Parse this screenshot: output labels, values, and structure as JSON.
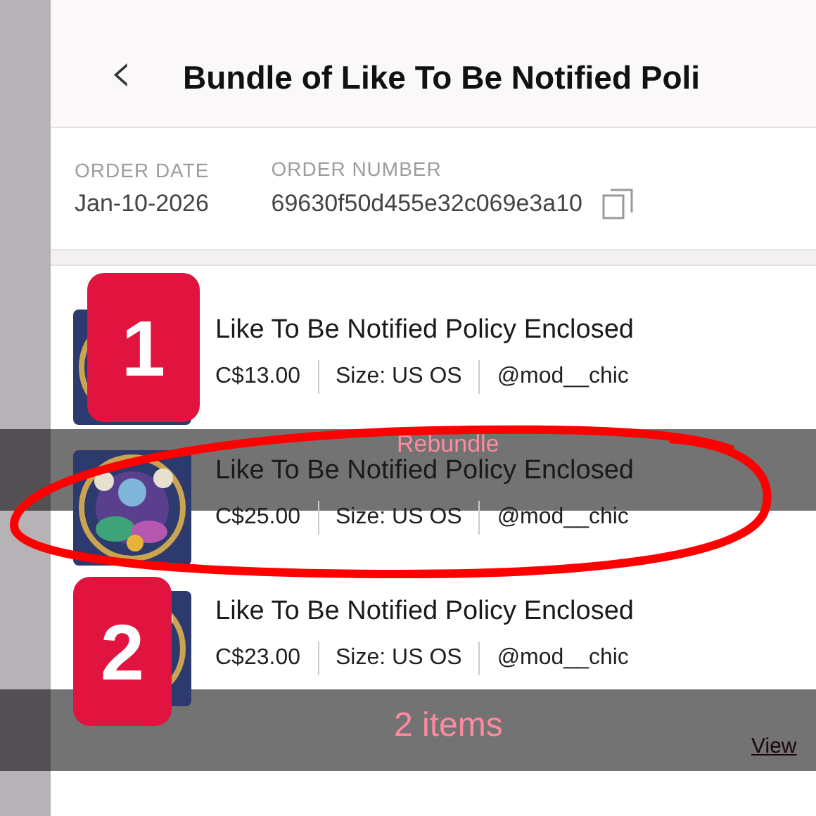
{
  "header": {
    "back": "‹",
    "title": "Bundle of Like To Be Notified Poli"
  },
  "order": {
    "date_label": "ORDER DATE",
    "date": "Jan-10-2026",
    "number_label": "ORDER NUMBER",
    "number": "69630f50d455e32c069e3a10"
  },
  "items": [
    {
      "title": "Like To Be Notified Policy Enclosed",
      "price": "C$13.00",
      "size": "Size: US OS",
      "seller": "@mod__chic"
    },
    {
      "title": "Like To Be Notified Policy Enclosed",
      "price": "C$25.00",
      "size": "Size: US OS",
      "seller": "@mod__chic"
    },
    {
      "title": "Like To Be Notified Policy Enclosed",
      "price": "C$23.00",
      "size": "Size: US OS",
      "seller": "@mod__chic"
    }
  ],
  "overlay_bars": [
    {
      "text": "Rebundle"
    },
    {
      "text": "2 items",
      "link": "View"
    }
  ],
  "badges": [
    "1",
    "2"
  ]
}
